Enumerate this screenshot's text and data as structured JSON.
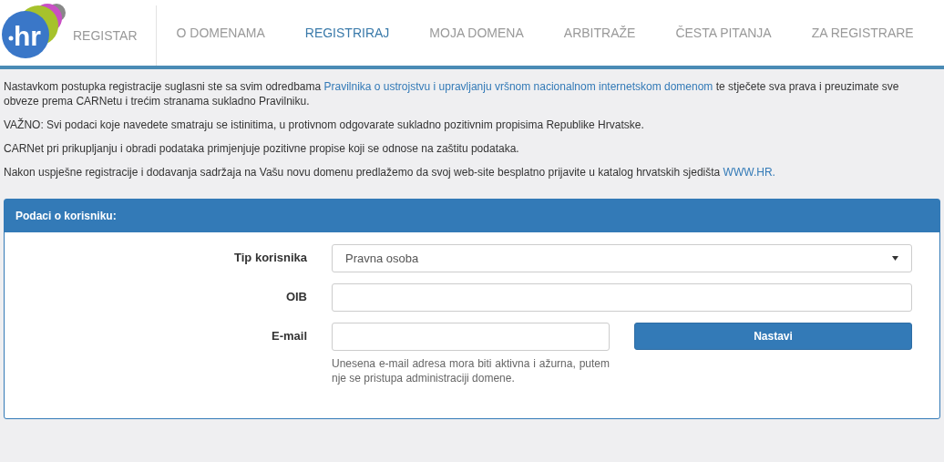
{
  "logo": {
    "text": "hr"
  },
  "nav": [
    {
      "label": "REGISTAR",
      "selected": false
    },
    {
      "label": "O DOMENAMA",
      "selected": false
    },
    {
      "label": "REGISTRIRAJ",
      "selected": true
    },
    {
      "label": "MOJA DOMENA",
      "selected": false
    },
    {
      "label": "ARBITRAŽE",
      "selected": false
    },
    {
      "label": "ČESTA PITANJA",
      "selected": false
    },
    {
      "label": "ZA REGISTRARE",
      "selected": false
    }
  ],
  "paragraphs": [
    {
      "segments": [
        {
          "kind": "text",
          "text": "Nastavkom postupka registracije suglasni ste sa svim odredbama "
        },
        {
          "kind": "link",
          "text": "Pravilnika o ustrojstvu i upravljanju vršnom nacionalnom internetskom domenom"
        },
        {
          "kind": "text",
          "text": " te stječete sva prava i preuzimate sve obveze prema CARNetu i trećim stranama sukladno Pravilniku."
        }
      ]
    },
    {
      "segments": [
        {
          "kind": "text",
          "text": "VAŽNO: Svi podaci koje navedete smatraju se istinitima, u protivnom odgovarate sukladno pozitivnim propisima Republike Hrvatske."
        }
      ]
    },
    {
      "segments": [
        {
          "kind": "text",
          "text": "CARNet pri prikupljanju i obradi podataka primjenjuje pozitivne propise koji se odnose na zaštitu podataka."
        }
      ]
    },
    {
      "segments": [
        {
          "kind": "text",
          "text": "Nakon uspješne registracije i dodavanja sadržaja na Vašu novu domenu predlažemo da svoj web-site besplatno prijavite u katalog hrvatskih sjedišta "
        },
        {
          "kind": "link",
          "text": "WWW.HR."
        }
      ]
    }
  ],
  "panel": {
    "title": "Podaci o korisniku:",
    "fields": [
      {
        "kind": "select",
        "label": "Tip korisnika",
        "value": "Pravna osoba"
      },
      {
        "kind": "input",
        "label": "OIB"
      },
      {
        "kind": "email",
        "label": "E-mail",
        "help": "Unesena e-mail adresa mora biti aktivna i ažurna, putem nje se pristupa administraciji domene.",
        "button": "Nastavi"
      }
    ]
  }
}
